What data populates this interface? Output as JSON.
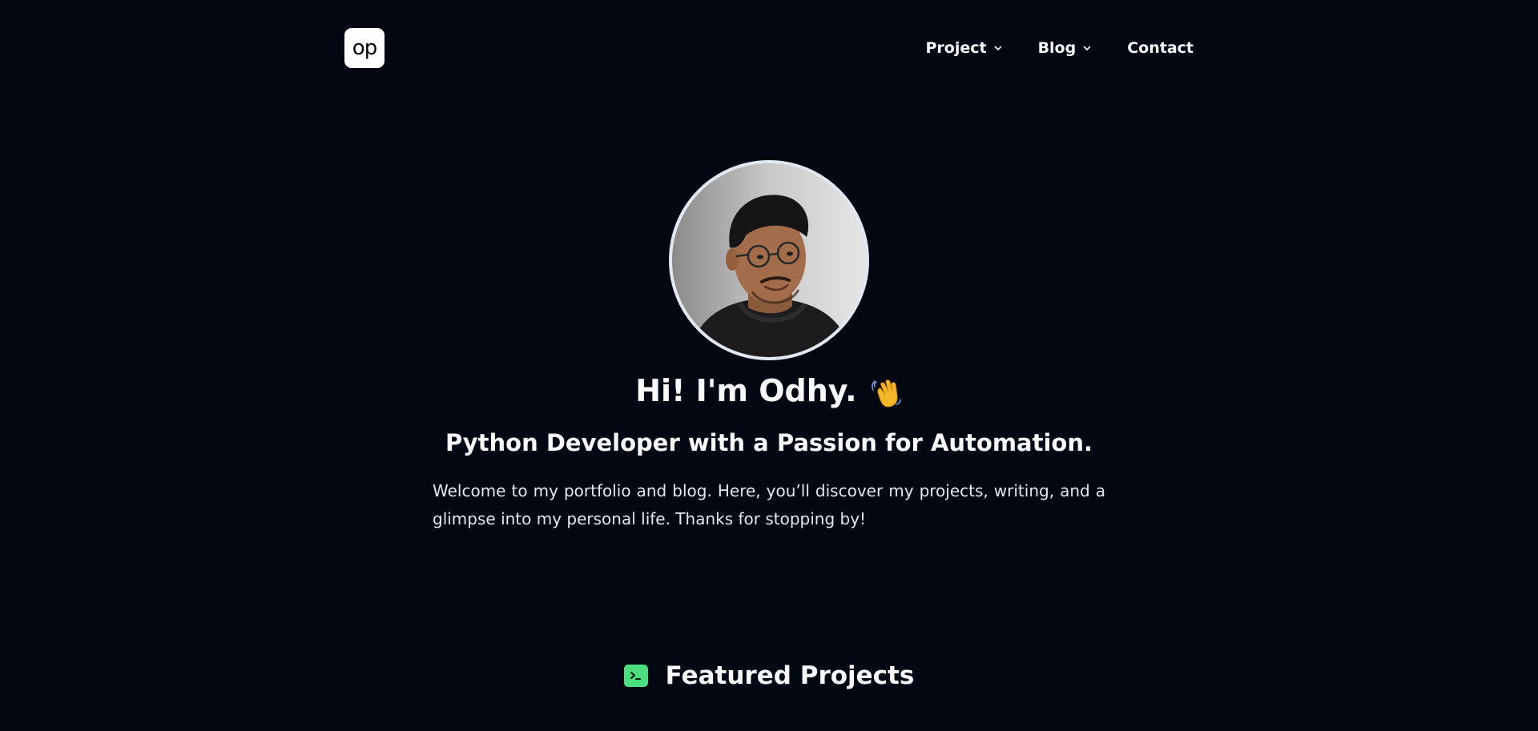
{
  "header": {
    "logo_text": "op",
    "nav": {
      "project": "Project",
      "blog": "Blog",
      "contact": "Contact"
    }
  },
  "hero": {
    "avatar_alt": "Profile photo",
    "title": "Hi! I'm Odhy.",
    "subtitle": "Python Developer with a Passion for Automation.",
    "intro": "Welcome to my portfolio and blog. Here, you’ll discover my projects, writing, and a glimpse into my personal life. Thanks for stopping by!"
  },
  "featured": {
    "title": "Featured Projects",
    "icon": "terminal-icon"
  },
  "colors": {
    "background": "#030711",
    "accent": "#4ade80",
    "text": "#f8fafc"
  }
}
